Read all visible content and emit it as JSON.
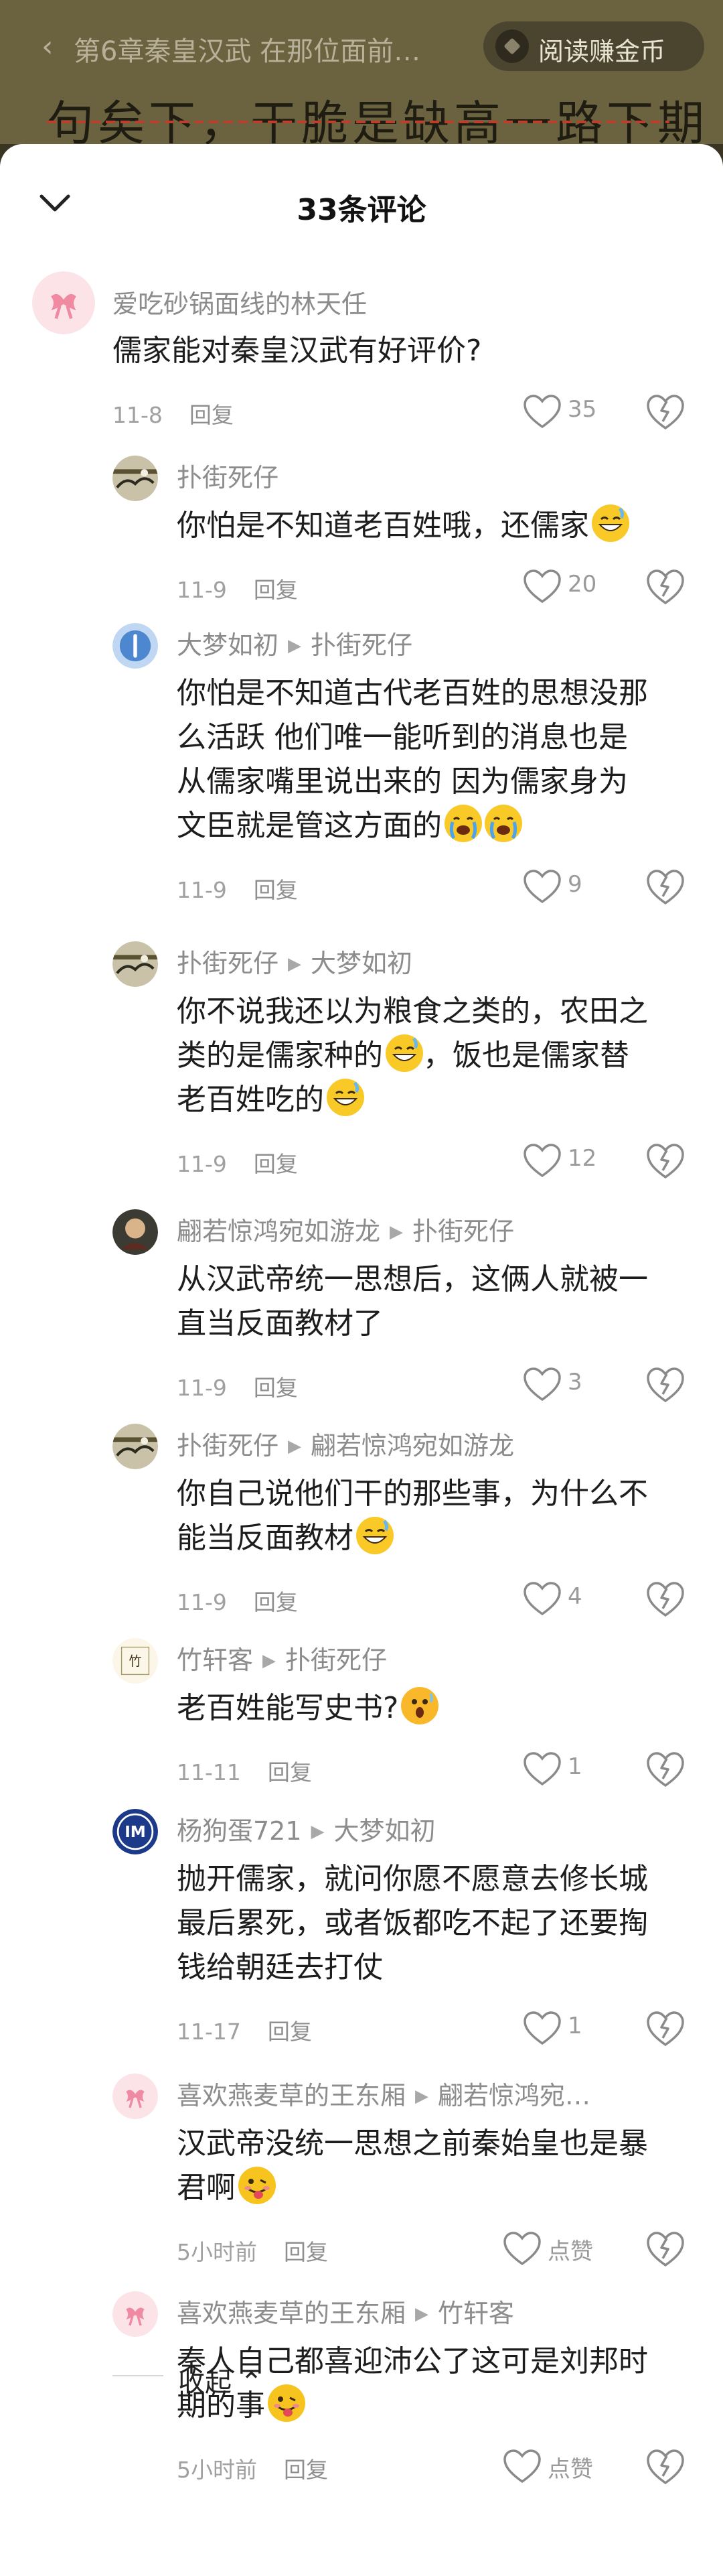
{
  "reader": {
    "back_glyph": "‹",
    "chapter_title": "第6章秦皇汉武 在那位面前…",
    "coin_label": "阅读赚金币",
    "body_snippet": "句矣下，干脆是缺高一路下期"
  },
  "sheet": {
    "title": "33条评论",
    "close_icon": "chevron-down-icon"
  },
  "comments": [
    {
      "user": "爱吃砂锅面线的林天任",
      "reply_to": "",
      "text": "儒家能对秦皇汉武有好评价?",
      "emoji": [],
      "date": "11-8",
      "reply_label": "回复",
      "likes": "35",
      "avatar": "pink-bow"
    },
    {
      "user": "扑街死仔",
      "reply_to": "",
      "text": "你怕是不知道老百姓哦，还儒家",
      "emoji": [
        "grin-sweat"
      ],
      "date": "11-9",
      "reply_label": "回复",
      "likes": "20",
      "avatar": "landscape"
    },
    {
      "user": "大梦如初",
      "reply_to": "扑街死仔",
      "text_lines": [
        "你怕是不知道古代老百姓的思想没那",
        "么活跃   他们唯一能听到的消息也是",
        "从儒家嘴里说出来的   因为儒家身为",
        "文臣就是管这方面的"
      ],
      "emoji": [
        "cry",
        "cry"
      ],
      "date": "11-9",
      "reply_label": "回复",
      "likes": "9",
      "avatar": "blue-circle"
    },
    {
      "user": "扑街死仔",
      "reply_to": "大梦如初",
      "text_lines": [
        "你不说我还以为粮食之类的，农田之",
        "类的是儒家种的",
        "，饭也是儒家替",
        "老百姓吃的"
      ],
      "emoji": [
        "grin-sweat",
        "grin-sweat"
      ],
      "date": "11-9",
      "reply_label": "回复",
      "likes": "12",
      "avatar": "landscape"
    },
    {
      "user": "翩若惊鸿宛如游龙",
      "reply_to": "扑街死仔",
      "text_lines": [
        "从汉武帝统一思想后，这俩人就被一",
        "直当反面教材了"
      ],
      "emoji": [],
      "date": "11-9",
      "reply_label": "回复",
      "likes": "3",
      "avatar": "dark-round"
    },
    {
      "user": "扑街死仔",
      "reply_to": "翩若惊鸿宛如游龙",
      "text_lines": [
        "你自己说他们干的那些事，为什么不",
        "能当反面教材"
      ],
      "emoji": [
        "grin-sweat"
      ],
      "date": "11-9",
      "reply_label": "回复",
      "likes": "4",
      "avatar": "landscape"
    },
    {
      "user": "竹轩客",
      "reply_to": "扑街死仔",
      "text": "老百姓能写史书?",
      "emoji": [
        "shock"
      ],
      "date": "11-11",
      "reply_label": "回复",
      "likes": "1",
      "avatar": "calligraphy"
    },
    {
      "user": "杨狗蛋721",
      "reply_to": "大梦如初",
      "text_lines": [
        "抛开儒家，就问你愿不愿意去修长城",
        "最后累死，或者饭都吃不起了还要掏",
        "钱给朝廷去打仗"
      ],
      "emoji": [],
      "date": "11-17",
      "reply_label": "回复",
      "likes": "1",
      "avatar": "inter-logo"
    },
    {
      "user": "喜欢燕麦草的王东厢",
      "reply_to": "翩若惊鸿宛…",
      "text_lines": [
        "汉武帝没统一思想之前秦始皇也是暴",
        "君啊"
      ],
      "emoji": [
        "tongue"
      ],
      "date": "5小时前",
      "reply_label": "回复",
      "likes": "点赞",
      "avatar": "pink-bow"
    },
    {
      "user": "喜欢燕麦草的王东厢",
      "reply_to": "竹轩客",
      "text_lines": [
        "秦人自己都喜迎沛公了这可是刘邦时",
        "期的事"
      ],
      "emoji": [
        "tongue"
      ],
      "date": "5小时前",
      "reply_label": "回复",
      "likes": "点赞",
      "avatar": "pink-bow"
    }
  ],
  "footer": {
    "collapse_label": "收起 ⌃"
  },
  "colors": {
    "accent_text": "#1d1d1d",
    "muted": "#8c8c8c",
    "dim_bg": "#6b6240"
  }
}
